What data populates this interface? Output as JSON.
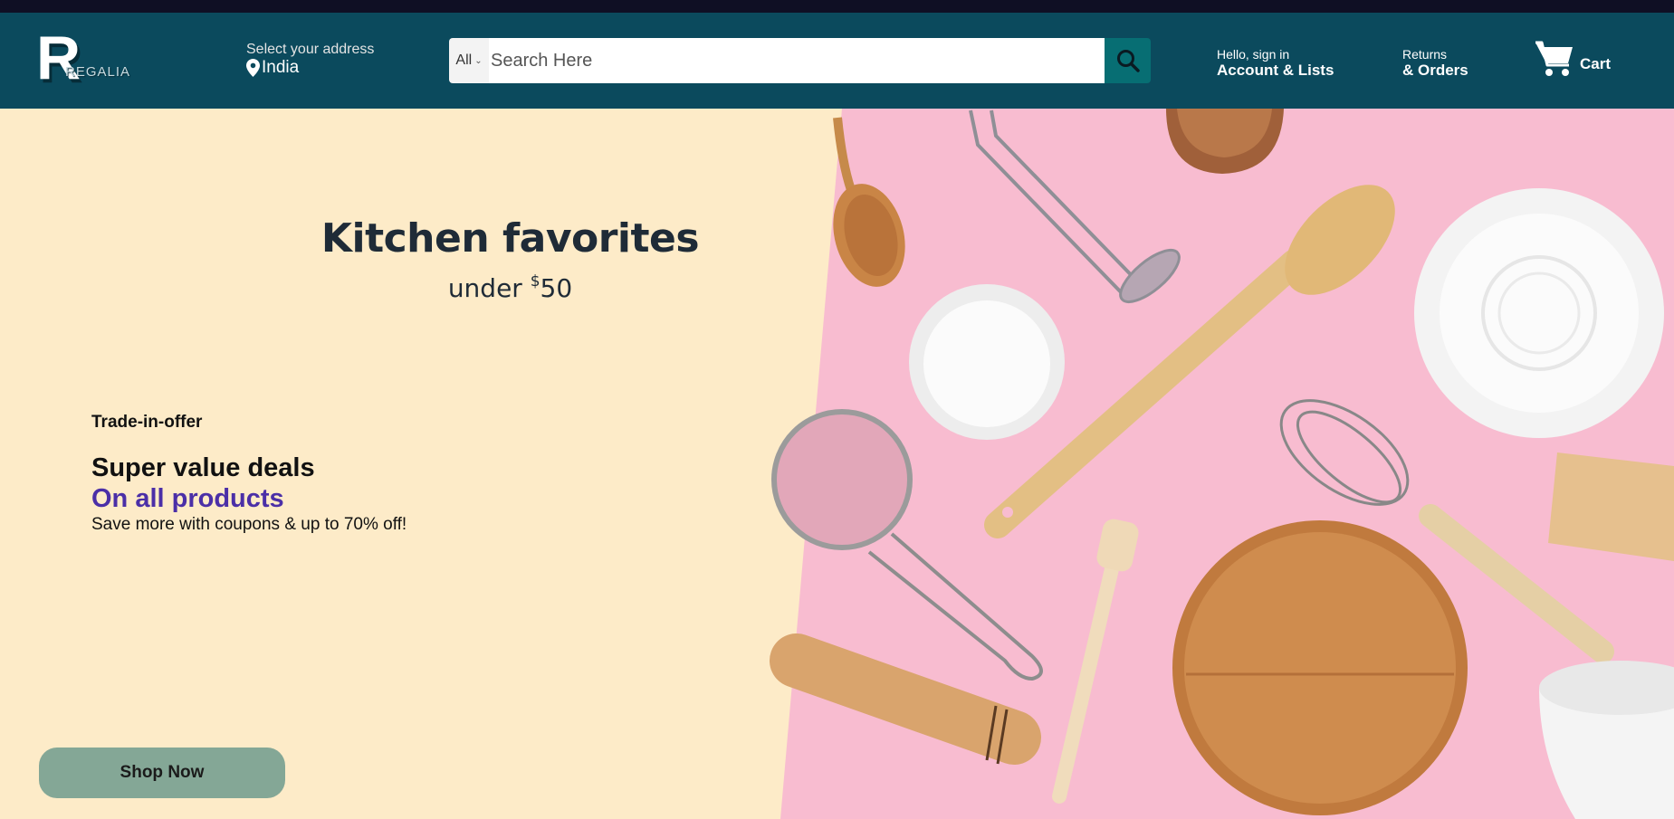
{
  "brand": {
    "logo_letter": "R",
    "logo_word": "REGALIA"
  },
  "address": {
    "prompt": "Select your address",
    "country": "India"
  },
  "search": {
    "category": "All",
    "placeholder": "Search Here"
  },
  "account": {
    "line1": "Hello, sign in",
    "line2": "Account & Lists"
  },
  "returns": {
    "line1": "Returns",
    "line2": "& Orders"
  },
  "cart": {
    "label": "Cart"
  },
  "hero": {
    "title": "Kitchen favorites",
    "subtitle_prefix": "under ",
    "subtitle_currency": "$",
    "subtitle_amount": "50",
    "offer_tag": "Trade-in-offer",
    "headline": "Super value deals",
    "headline_accent": "On all products",
    "description": "Save more with coupons & up to 70% off!",
    "cta": "Shop Now"
  },
  "colors": {
    "navbar": "#0b4a5d",
    "search_button": "#076e73",
    "hero_background": "#fdebc8",
    "photo_background": "#f8bcd0",
    "accent_text": "#4b2fa7",
    "cta_button": "#84a796"
  },
  "icons": [
    "location-pin-icon",
    "chevron-down-icon",
    "search-icon",
    "cart-icon"
  ]
}
